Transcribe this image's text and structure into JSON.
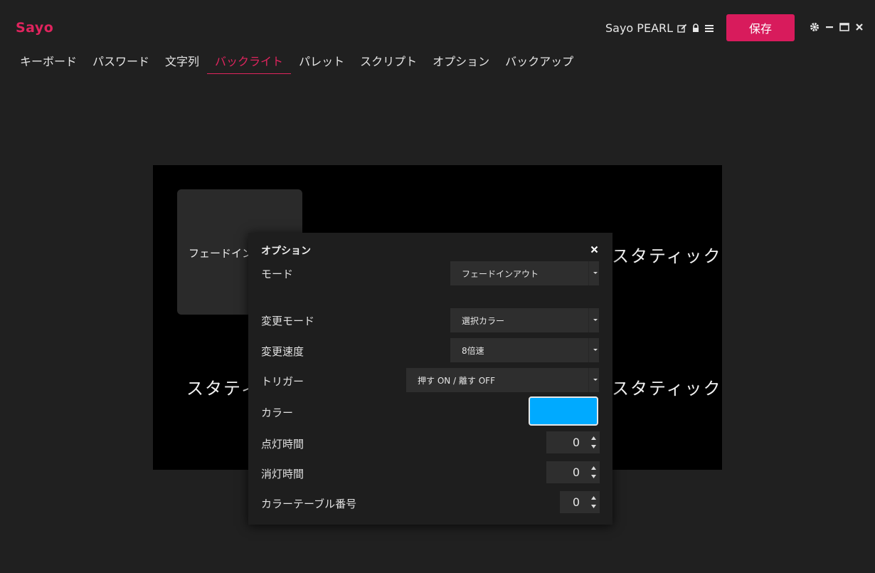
{
  "app": {
    "title": "Sayo"
  },
  "device": {
    "name": "Sayo PEARL"
  },
  "toolbar": {
    "save_label": "保存"
  },
  "tabs": [
    {
      "label": "キーボード"
    },
    {
      "label": "パスワード"
    },
    {
      "label": "文字列"
    },
    {
      "label": "バックライト",
      "active": true
    },
    {
      "label": "パレット"
    },
    {
      "label": "スクリプト"
    },
    {
      "label": "オプション"
    },
    {
      "label": "バックアップ"
    }
  ],
  "backlight": {
    "card_label": "フェードイン",
    "top_right_label": "スタティック",
    "bottom_left_label": "スタティ",
    "bottom_right_label": "スタティック"
  },
  "modal": {
    "title": "オプション",
    "mode": {
      "label": "モード",
      "value": "フェードインアウト"
    },
    "change_mode": {
      "label": "変更モード",
      "value": "選択カラー"
    },
    "change_speed": {
      "label": "変更速度",
      "value": "8倍速"
    },
    "trigger": {
      "label": "トリガー",
      "value": "押す ON / 離す OFF"
    },
    "color": {
      "label": "カラー",
      "value": "#00aaff"
    },
    "on_time": {
      "label": "点灯時間",
      "value": "0"
    },
    "off_time": {
      "label": "消灯時間",
      "value": "0"
    },
    "color_table": {
      "label": "カラーテーブル番号",
      "value": "0"
    }
  },
  "colors": {
    "accent": "#e0245e",
    "selected_color": "#00aaff"
  }
}
